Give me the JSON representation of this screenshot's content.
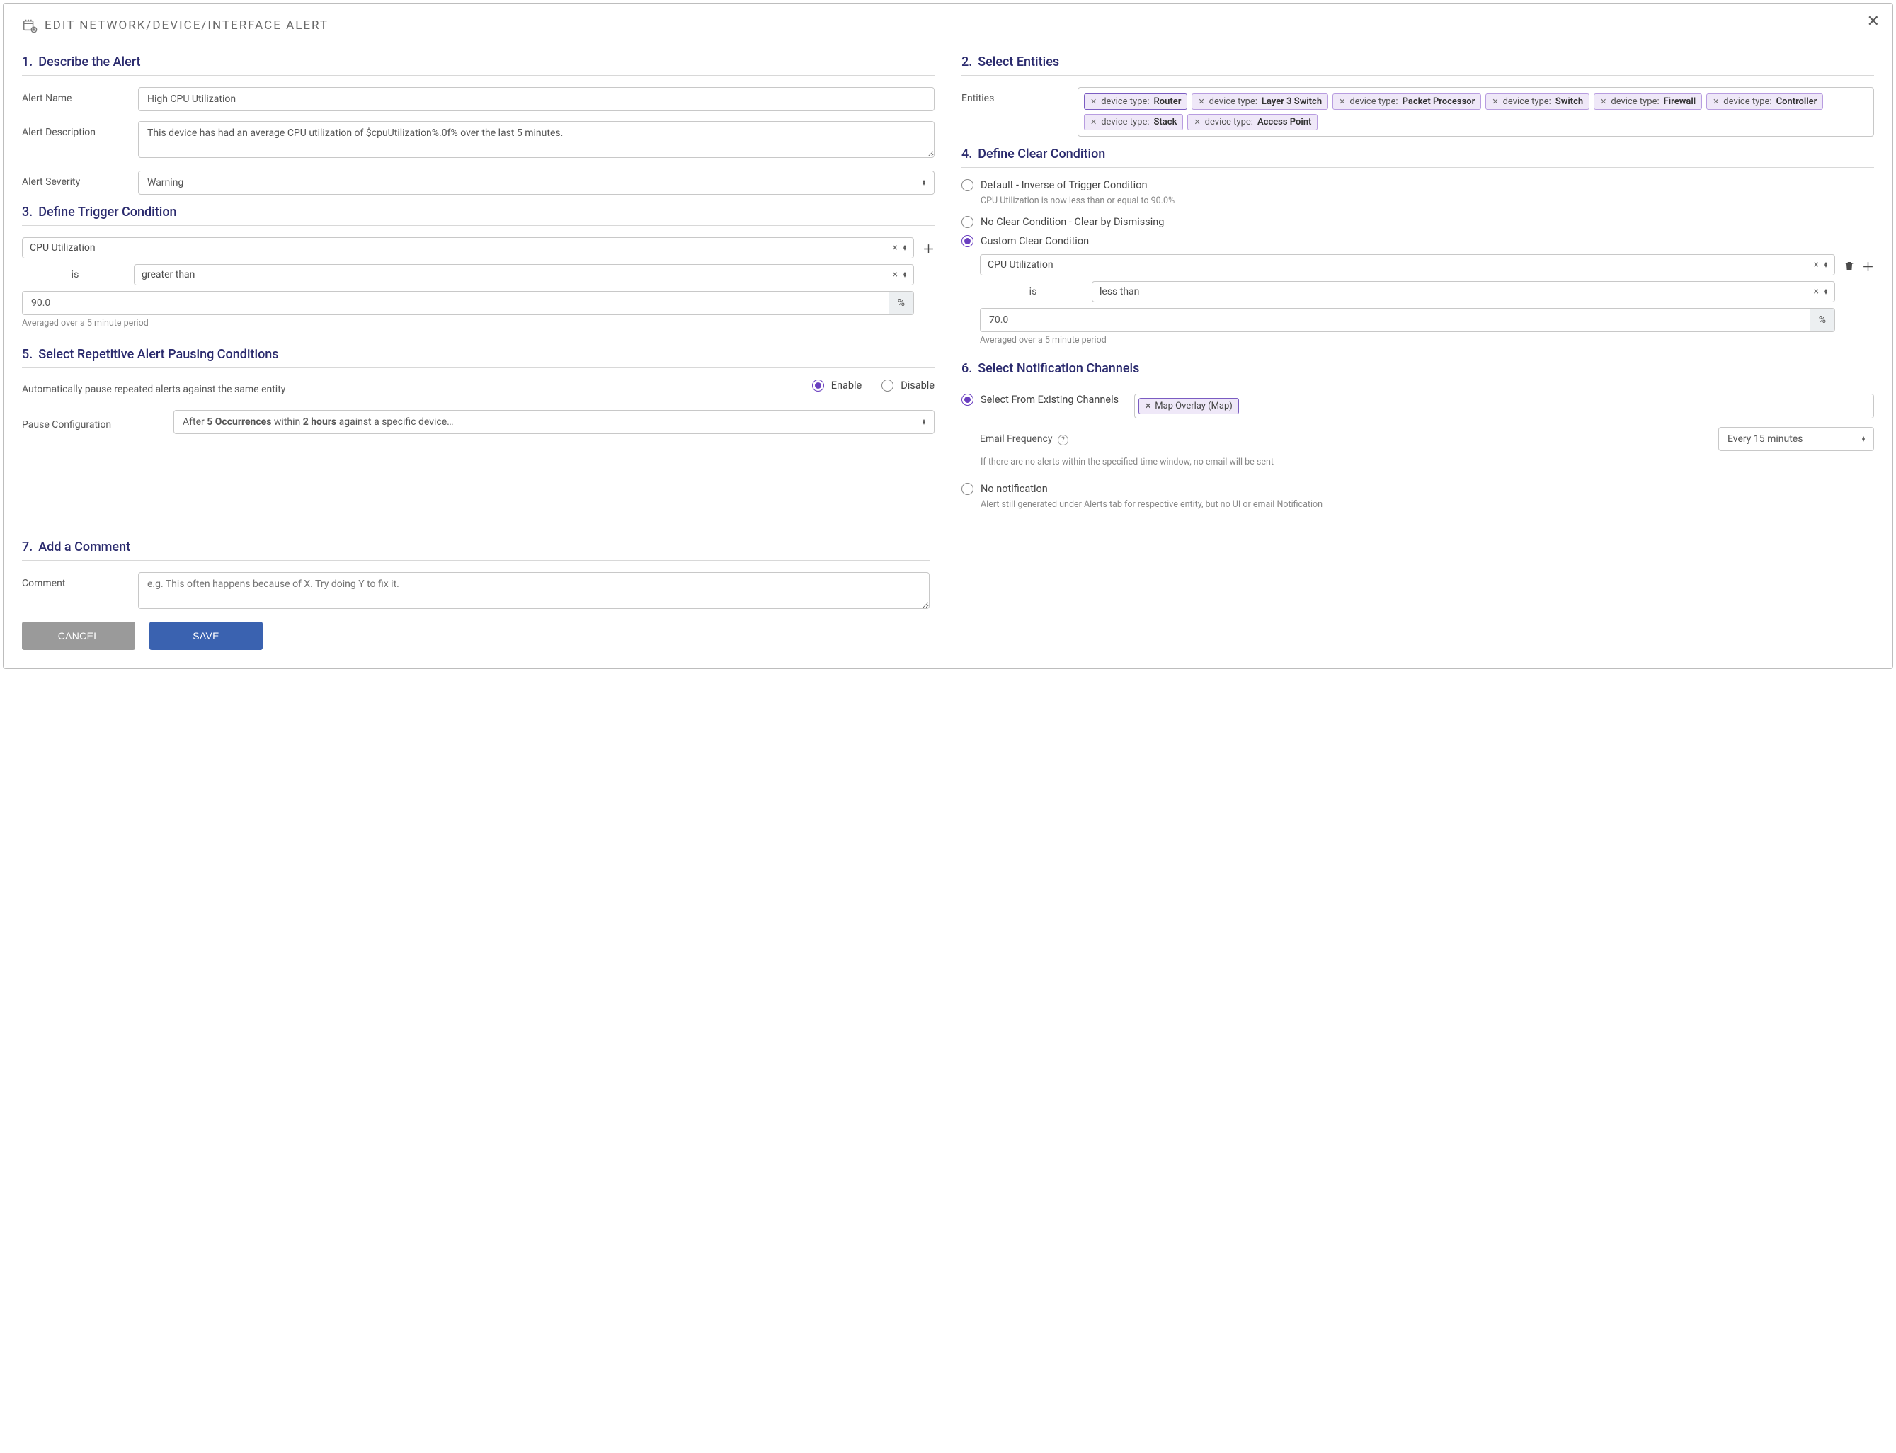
{
  "modal": {
    "title": "EDIT NETWORK/DEVICE/INTERFACE ALERT"
  },
  "sections": {
    "s1": {
      "num": "1.",
      "title": "Describe the Alert"
    },
    "s2": {
      "num": "2.",
      "title": "Select Entities"
    },
    "s3": {
      "num": "3.",
      "title": "Define Trigger Condition"
    },
    "s4": {
      "num": "4.",
      "title": "Define Clear Condition"
    },
    "s5": {
      "num": "5.",
      "title": "Select Repetitive Alert Pausing Conditions"
    },
    "s6": {
      "num": "6.",
      "title": "Select Notification Channels"
    },
    "s7": {
      "num": "7.",
      "title": "Add a Comment"
    }
  },
  "describe": {
    "name_label": "Alert Name",
    "name_value": "High CPU Utilization",
    "desc_label": "Alert Description",
    "desc_value": "This device has had an average CPU utilization of $cpuUtilization%.0f% over the last 5 minutes.",
    "severity_label": "Alert Severity",
    "severity_value": "Warning"
  },
  "entities": {
    "label": "Entities",
    "prefix": "device type:",
    "items": [
      "Router",
      "Layer 3 Switch",
      "Packet Processor",
      "Switch",
      "Firewall",
      "Controller",
      "Stack",
      "Access Point"
    ]
  },
  "trigger": {
    "metric": "CPU Utilization",
    "is_label": "is",
    "operator": "greater than",
    "value": "90.0",
    "unit": "%",
    "helper": "Averaged over a 5 minute period"
  },
  "clear": {
    "opt1_label": "Default - Inverse of Trigger Condition",
    "opt1_sub": "CPU Utilization is now less than or equal to 90.0%",
    "opt2_label": "No Clear Condition - Clear by Dismissing",
    "opt3_label": "Custom Clear Condition",
    "metric": "CPU Utilization",
    "is_label": "is",
    "operator": "less than",
    "value": "70.0",
    "unit": "%",
    "helper": "Averaged over a 5 minute period"
  },
  "pause": {
    "auto_label": "Automatically pause repeated alerts against the same entity",
    "enable": "Enable",
    "disable": "Disable",
    "config_label": "Pause Configuration",
    "config_text_pre": "After ",
    "config_text_b1": "5 Occurrences",
    "config_text_mid": " within ",
    "config_text_b2": "2 hours",
    "config_text_post": " against a specific device…"
  },
  "notify": {
    "opt1_label": "Select From Existing Channels",
    "channel": "Map Overlay (Map)",
    "freq_label": "Email Frequency",
    "freq_value": "Every 15 minutes",
    "freq_helper": "If there are no alerts within the specified time window, no email will be sent",
    "opt2_label": "No notification",
    "opt2_sub": "Alert still generated under Alerts tab for respective entity, but no UI or email Notification"
  },
  "comment": {
    "label": "Comment",
    "placeholder": "e.g. This often happens because of X. Try doing Y to fix it."
  },
  "buttons": {
    "cancel": "CANCEL",
    "save": "SAVE"
  }
}
